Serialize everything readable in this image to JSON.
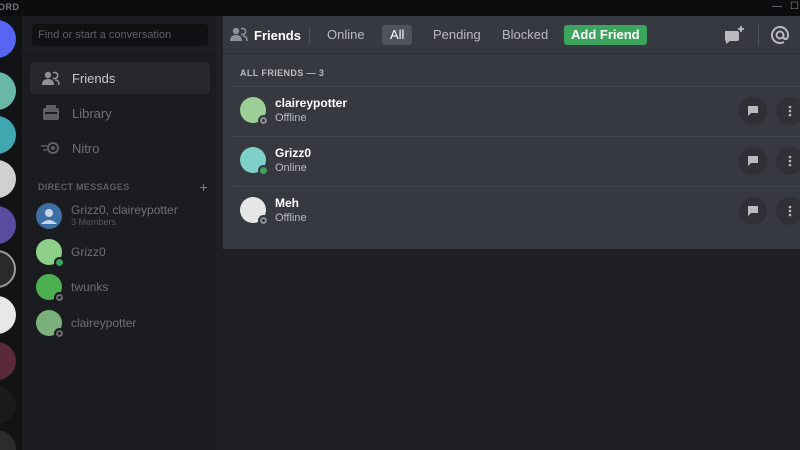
{
  "titlebar": {
    "brand": "ORD",
    "minimize": "—",
    "maximize": "☐"
  },
  "sidebar": {
    "search_placeholder": "Find or start a conversation",
    "nav": [
      {
        "label": "Friends",
        "icon": "friends-icon",
        "active": true
      },
      {
        "label": "Library",
        "icon": "library-icon",
        "active": false
      },
      {
        "label": "Nitro",
        "icon": "nitro-icon",
        "active": false
      }
    ],
    "dm_header": "DIRECT MESSAGES",
    "dm_add": "+",
    "dms": [
      {
        "name": "Grizz0, claireypotter",
        "sub": "3 Members"
      },
      {
        "name": "Grizz0",
        "status": "online"
      },
      {
        "name": "twunks",
        "status": "offline"
      },
      {
        "name": "claireypotter",
        "status": "offline"
      }
    ]
  },
  "topbar": {
    "title": "Friends",
    "tabs": [
      "Online",
      "All",
      "Pending",
      "Blocked"
    ],
    "selected_tab": "All",
    "add_friend": "Add Friend"
  },
  "friends": {
    "section_label": "ALL FRIENDS — 3",
    "list": [
      {
        "name": "claireypotter",
        "status": "Offline"
      },
      {
        "name": "Grizz0",
        "status": "Online"
      },
      {
        "name": "Meh",
        "status": "Offline"
      }
    ]
  },
  "colors": {
    "accent_green": "#3ba55d",
    "panel_bg": "#36393f",
    "sidebar_bg": "#1b1c1f"
  }
}
